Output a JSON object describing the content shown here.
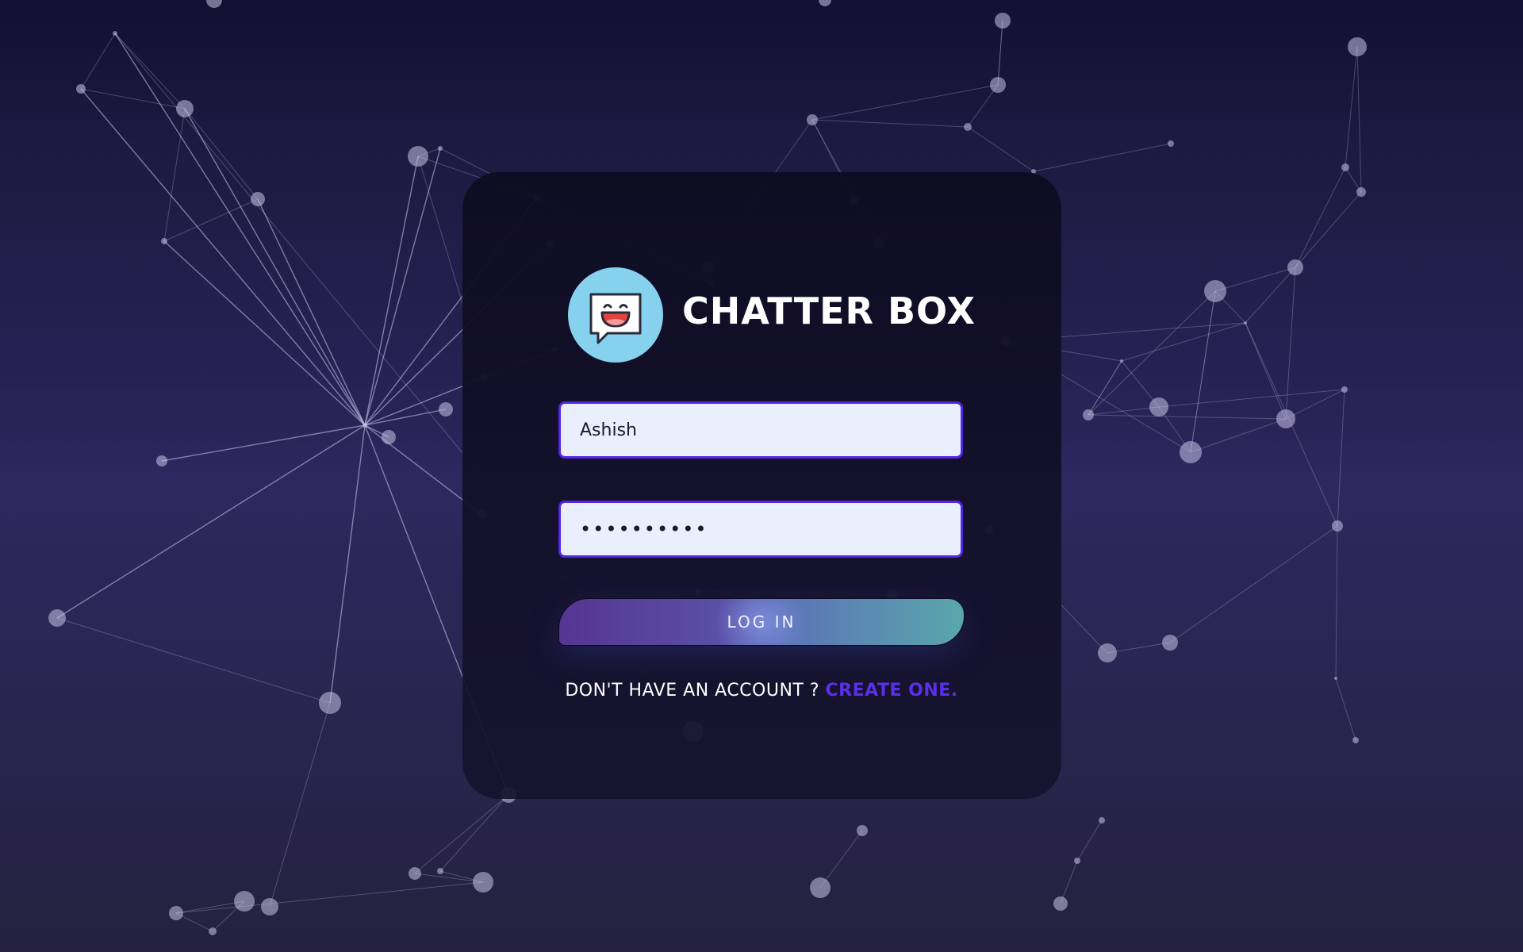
{
  "brand": {
    "name": "CHATTER BOX",
    "logo_icon": "laughing-chat-bubble-icon"
  },
  "login_form": {
    "username_value": "Ashish",
    "password_masked": "••••••••••",
    "login_label": "LOG IN",
    "signup_prompt": "DON'T HAVE AN ACCOUNT ?",
    "signup_link": "CREATE ONE."
  },
  "colors": {
    "accent": "#5326e6",
    "link": "#5a2fe8",
    "logo_background": "#86d2ee",
    "input_background": "#e9effc"
  }
}
